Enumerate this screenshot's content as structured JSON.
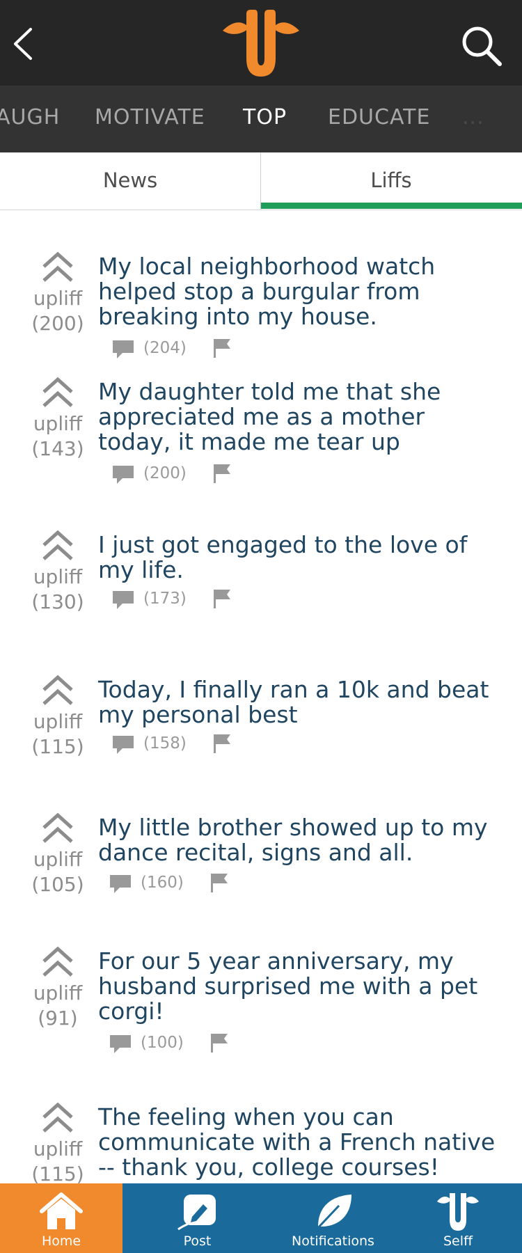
{
  "appbar": {
    "back_icon": "chevron-left-icon",
    "logo_icon": "giraffe-logo-icon",
    "search_icon": "search-icon",
    "logo_color": "#f08a2c"
  },
  "categories": [
    {
      "label": "AUGH",
      "active": false
    },
    {
      "label": "MOTIVATE",
      "active": false
    },
    {
      "label": "TOP",
      "active": true
    },
    {
      "label": "EDUCATE",
      "active": false
    },
    {
      "label": "...",
      "active": false
    }
  ],
  "tabs": {
    "news": "News",
    "liffs": "Liffs",
    "active": "liffs",
    "accent": "#1e9e5a"
  },
  "posts": [
    {
      "upliff_label": "upliff",
      "count": "(200)",
      "text": "My local neighborhood watch helped stop a burgular from breaking into my house.",
      "comments": "(204)"
    },
    {
      "upliff_label": "upliff",
      "count": "(143)",
      "text": "My daughter told me that she appreciated me as a mother today, it made me tear up",
      "comments": "(200)"
    },
    {
      "upliff_label": "upliff",
      "count": "(130)",
      "text": "I just got engaged to the love of my life.",
      "comments": "(173)"
    },
    {
      "upliff_label": "upliff",
      "count": "(115)",
      "text": "Today, I finally ran a 10k and beat my personal best",
      "comments": "(158)"
    },
    {
      "upliff_label": "upliff",
      "count": "(105)",
      "text": "My little brother showed up to my dance recital, signs and all.",
      "comments": "(160)"
    },
    {
      "upliff_label": "upliff",
      "count": "(91)",
      "text": "For our 5 year anniversary, my husband surprised me with a pet corgi!",
      "comments": "(100)"
    },
    {
      "upliff_label": "upliff",
      "count": "(115)",
      "text": "The feeling when you can communicate with a French native -- thank you, college courses!",
      "comments": ""
    }
  ],
  "bottom_nav": {
    "home": "Home",
    "post": "Post",
    "notifications": "Notifications",
    "self": "Selff",
    "active": "home",
    "bar_color": "#1a6b9c",
    "active_color": "#f08a2c"
  }
}
